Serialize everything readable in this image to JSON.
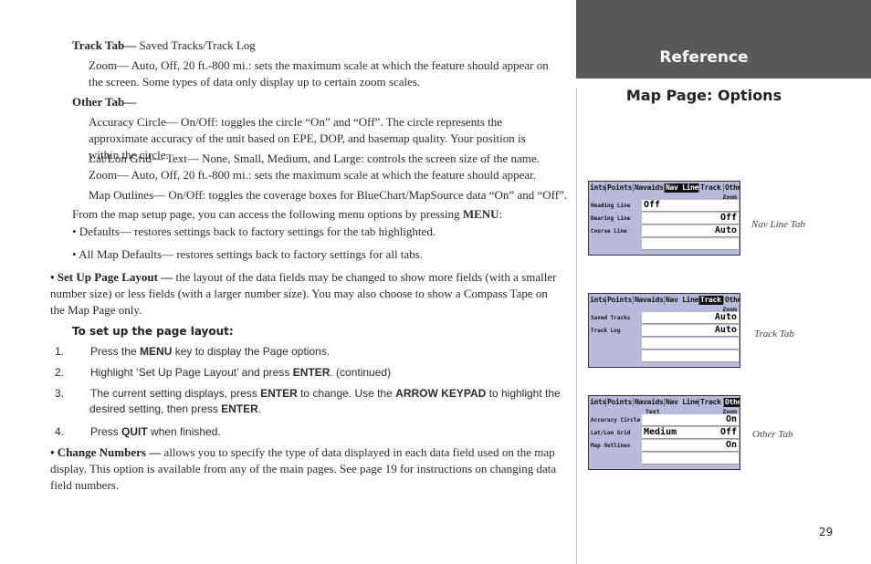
{
  "sidebar": {
    "section_label": "Reference",
    "page_title": "Map Page: Options",
    "page_number": "29"
  },
  "body": {
    "track_tab": {
      "title": "Track Tab—",
      "text": " Saved Tracks/Track Log"
    },
    "track_zoom": "Zoom— Auto, Off, 20 ft.-800 mi.: sets the maximum scale at which the feature should appear on the screen. Some types of data only display up to certain zoom scales.",
    "other_tab": {
      "title": "Other Tab—"
    },
    "accuracy_circle": "Accuracy Circle— On/Off: toggles the circle “On” and “Off”. The circle represents the approximate accuracy of the unit based on EPE, DOP, and basemap quality. Your position is within the circle.",
    "latlon_grid_1": "Lat/Lon Grid— Text— None, Small, Medium, and Large: controls the screen size of the name.",
    "latlon_grid_2": "Zoom— Auto, Off, 20 ft.-800 mi.: sets the maximum scale at which the feature should appear.",
    "map_outlines": "Map Outlines— On/Off: toggles the coverage boxes for BlueChart/MapSource data “On” and “Off”.",
    "menu_intro": {
      "text": "From the map setup page, you can access the following menu options by pressing ",
      "key": "MENU",
      "suffix": ":"
    },
    "defaults": "• Defaults— restores settings back to factory settings for the tab highlighted.",
    "all_defaults": "• All Map Defaults— restores settings back to factory settings for all tabs.",
    "setup_layout": {
      "lead": "• Set Up Page Layout —",
      "text": " the layout of the data fields may be changed to show more fields (with a smaller number size) or less fields (with a larger number size). You may also choose to show a Compass Tape on the Map Page only."
    },
    "procedure_title": "To set up the page layout:",
    "steps": [
      {
        "num": "1.",
        "parts": [
          "Press the ",
          "MENU",
          " key to display the Page options."
        ]
      },
      {
        "num": "2.",
        "parts": [
          "Highlight ‘Set Up Page Layout’ and press ",
          "ENTER",
          ". (continued)"
        ]
      },
      {
        "num": "3.",
        "parts": [
          "The current setting displays, press ",
          "ENTER",
          " to change. Use the ",
          "ARROW KEYPAD",
          " to highlight the desired setting, then press ",
          "ENTER",
          "."
        ]
      },
      {
        "num": "4.",
        "parts": [
          "Press ",
          "QUIT",
          " when finished."
        ]
      }
    ],
    "change_numbers": {
      "lead": "• Change Numbers —",
      "text": " allows you to specify the type of data displayed in each data field used on the map display. This option is available from any of the main pages. See page 19 for instructions on changing data field numbers."
    }
  },
  "screens": [
    {
      "caption": "Nav Line Tab",
      "tabs": [
        "ints",
        "Points",
        "Navaids",
        "Nav Line",
        "Track",
        "Other"
      ],
      "selected_tab": 3,
      "col_text": "",
      "col_zoom": "Zoom",
      "rows": [
        {
          "label": "Heading Line",
          "text": "Off",
          "zoom": ""
        },
        {
          "label": "Bearing Line",
          "text": "",
          "zoom": "Off"
        },
        {
          "label": "Course Line",
          "text": "",
          "zoom": "Auto"
        },
        {
          "label": "",
          "text": "",
          "zoom": ""
        }
      ]
    },
    {
      "caption": "Track Tab",
      "tabs": [
        "ints",
        "Points",
        "Navaids",
        "Nav Line",
        "Track",
        "Other"
      ],
      "selected_tab": 4,
      "col_text": "",
      "col_zoom": "Zoom",
      "rows": [
        {
          "label": "Saved Tracks",
          "text": "",
          "zoom": "Auto"
        },
        {
          "label": "Track Log",
          "text": "",
          "zoom": "Auto"
        },
        {
          "label": "",
          "text": "",
          "zoom": ""
        },
        {
          "label": "",
          "text": "",
          "zoom": ""
        }
      ]
    },
    {
      "caption": "Other Tab",
      "tabs": [
        "ints",
        "Points",
        "Navaids",
        "Nav Line",
        "Track",
        "Other"
      ],
      "selected_tab": 5,
      "col_text": "Text",
      "col_zoom": "Zoom",
      "rows": [
        {
          "label": "Accuracy Circle",
          "text": "",
          "zoom": "On"
        },
        {
          "label": "Lat/Lon Grid",
          "text": "Medium",
          "zoom": "Off"
        },
        {
          "label": "Map Outlines",
          "text": "",
          "zoom": "On"
        },
        {
          "label": "",
          "text": "",
          "zoom": ""
        }
      ]
    }
  ]
}
